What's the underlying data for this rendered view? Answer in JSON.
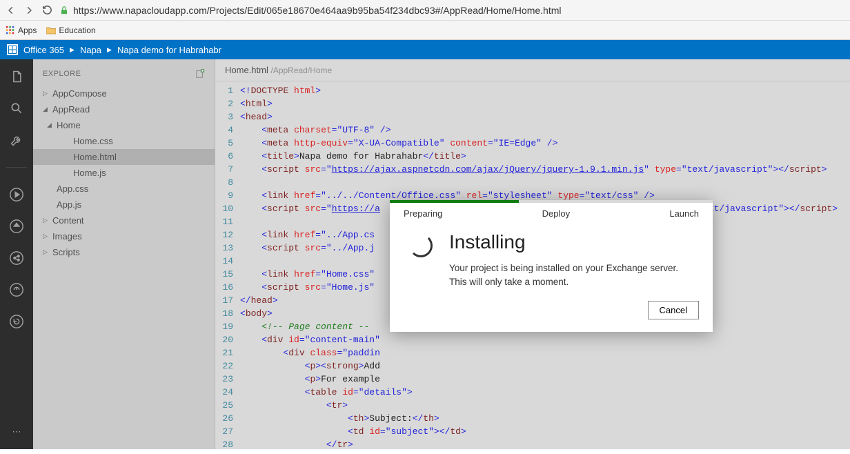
{
  "browser": {
    "url": "https://www.napacloudapp.com/Projects/Edit/065e18670e464aa9b95ba54f234dbc93#/AppRead/Home/Home.html",
    "bookmarks": {
      "apps": "Apps",
      "education": "Education"
    }
  },
  "header": {
    "brand": "Office 365",
    "crumbs": [
      "Napa",
      "Napa demo for Habrahabr"
    ]
  },
  "sidebar": {
    "title": "EXPLORE",
    "items": {
      "appcompose": "AppCompose",
      "appread": "AppRead",
      "home": "Home",
      "home_css": "Home.css",
      "home_html": "Home.html",
      "home_js": "Home.js",
      "app_css": "App.css",
      "app_js": "App.js",
      "content": "Content",
      "images": "Images",
      "scripts": "Scripts"
    }
  },
  "editor": {
    "tab_title": "Home.html",
    "tab_path": "/AppRead/Home"
  },
  "modal": {
    "steps": {
      "prepare": "Preparing",
      "deploy": "Deploy",
      "launch": "Launch"
    },
    "title": "Installing",
    "text1": "Your project is being installed on your Exchange server.",
    "text2": "This will only take a moment.",
    "cancel": "Cancel"
  }
}
